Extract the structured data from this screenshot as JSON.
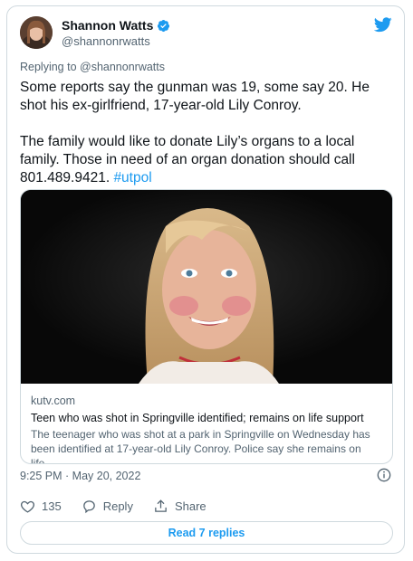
{
  "author": {
    "name": "Shannon Watts",
    "handle": "@shannonrwatts",
    "verified": true
  },
  "reply_to": "Replying to @shannonrwatts",
  "tweet": {
    "text_main": "Some reports say the gunman was 19, some say 20. He shot his ex-girlfriend, 17-year-old Lily Conroy.\n\nThe family would like to donate Lily’s organs to a local family. Those in need of an organ donation should call 801.489.9421. ",
    "hashtag": "#utpol"
  },
  "link_card": {
    "domain": "kutv.com",
    "title": "Teen who was shot in Springville identified; remains on life support",
    "description": "The teenager who was shot at a park in Springville on Wednesday has been identified at 17-year-old Lily Conroy. Police say she remains on life..."
  },
  "timestamp": "9:25 PM · May 20, 2022",
  "actions": {
    "likes": "135",
    "reply_label": "Reply",
    "share_label": "Share"
  },
  "read_replies": "Read 7 replies",
  "colors": {
    "accent": "#1d9bf0",
    "secondary_text": "#536471",
    "like_red": "#f91880"
  },
  "icons": [
    "twitter-bird-icon",
    "verified-badge-icon",
    "info-icon",
    "heart-icon",
    "reply-icon",
    "share-icon"
  ]
}
